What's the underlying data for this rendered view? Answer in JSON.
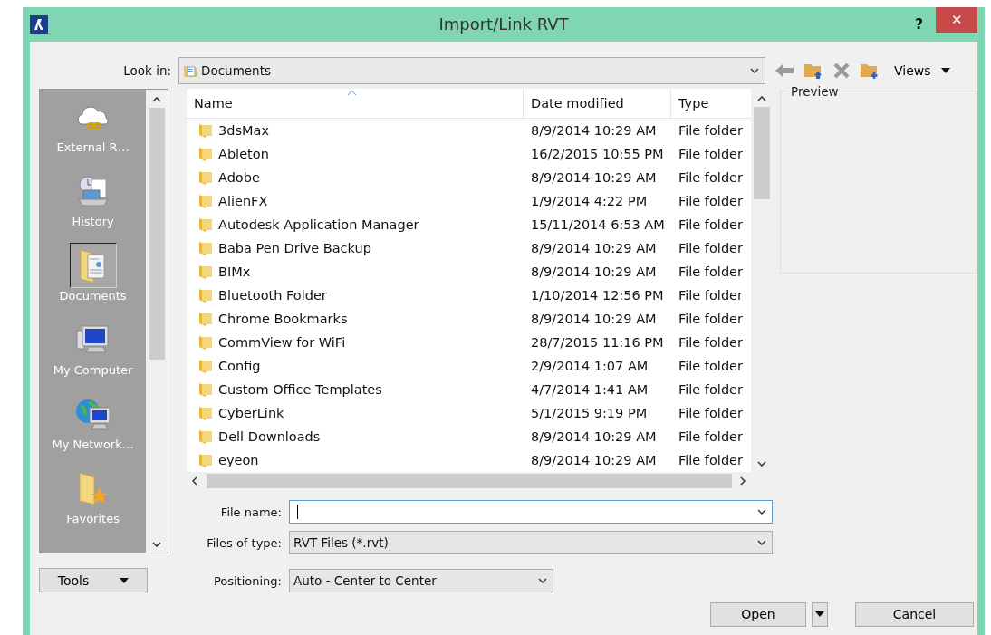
{
  "window": {
    "title": "Import/Link RVT",
    "help": "?",
    "close": "✕"
  },
  "look_in": {
    "label": "Look in:",
    "value": "Documents"
  },
  "toolbar": {
    "views": "Views"
  },
  "places": [
    {
      "label": "External R…",
      "kind": "cloud",
      "selected": false
    },
    {
      "label": "History",
      "kind": "history",
      "selected": false
    },
    {
      "label": "Documents",
      "kind": "documents",
      "selected": true
    },
    {
      "label": "My Computer",
      "kind": "computer",
      "selected": false
    },
    {
      "label": "My Network…",
      "kind": "network",
      "selected": false
    },
    {
      "label": "Favorites",
      "kind": "favorites",
      "selected": false
    }
  ],
  "table": {
    "columns": [
      "Name",
      "Date modified",
      "Type"
    ],
    "rows": [
      [
        "3dsMax",
        "8/9/2014 10:29 AM",
        "File folder"
      ],
      [
        "Ableton",
        "16/2/2015 10:55 PM",
        "File folder"
      ],
      [
        "Adobe",
        "8/9/2014 10:29 AM",
        "File folder"
      ],
      [
        "AlienFX",
        "1/9/2014 4:22 PM",
        "File folder"
      ],
      [
        "Autodesk Application Manager",
        "15/11/2014 6:53 AM",
        "File folder"
      ],
      [
        "Baba Pen Drive Backup",
        "8/9/2014 10:29 AM",
        "File folder"
      ],
      [
        "BIMx",
        "8/9/2014 10:29 AM",
        "File folder"
      ],
      [
        "Bluetooth Folder",
        "1/10/2014 12:56 PM",
        "File folder"
      ],
      [
        "Chrome Bookmarks",
        "8/9/2014 10:29 AM",
        "File folder"
      ],
      [
        "CommView for WiFi",
        "28/7/2015 11:16 PM",
        "File folder"
      ],
      [
        "Config",
        "2/9/2014 1:07 AM",
        "File folder"
      ],
      [
        "Custom Office Templates",
        "4/7/2014 1:41 AM",
        "File folder"
      ],
      [
        "CyberLink",
        "5/1/2015 9:19 PM",
        "File folder"
      ],
      [
        "Dell Downloads",
        "8/9/2014 10:29 AM",
        "File folder"
      ],
      [
        "eyeon",
        "8/9/2014 10:29 AM",
        "File folder"
      ]
    ]
  },
  "preview": {
    "label": "Preview"
  },
  "file_name": {
    "label": "File name:"
  },
  "file_type": {
    "label": "Files of type:",
    "value": "RVT Files  (*.rvt)"
  },
  "positioning": {
    "label": "Positioning:",
    "value": "Auto - Center to Center"
  },
  "buttons": {
    "tools": "Tools",
    "open": "Open",
    "cancel": "Cancel"
  }
}
